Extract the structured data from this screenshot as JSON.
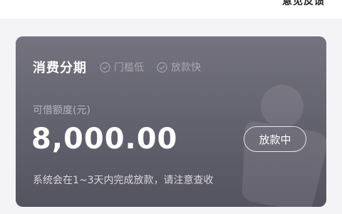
{
  "header": {
    "feedback_label": "意见反馈"
  },
  "card": {
    "title": "消费分期",
    "tags": [
      "门槛低",
      "放款快"
    ],
    "amount_label": "可借额度(元)",
    "amount": "8,000.00",
    "action_label": "放款中",
    "note": "系统会在1~3天内完成放款，请注意查收",
    "colors": {
      "card_bg": "#67666f",
      "title": "#ffffff",
      "tag": "#a8a7b2"
    }
  }
}
